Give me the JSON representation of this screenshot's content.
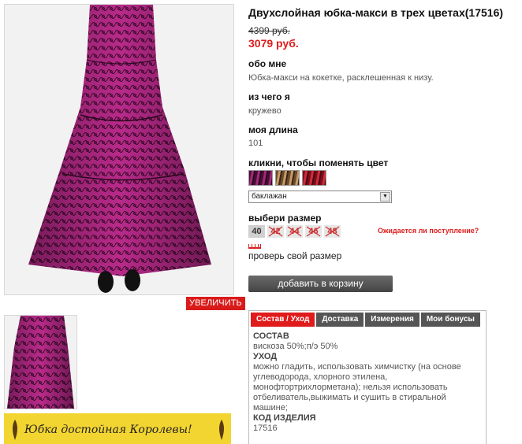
{
  "product": {
    "title": "Двухслойная юбка-макси в трех цветах(17516)",
    "old_price": "4399 руб.",
    "new_price": "3079 руб."
  },
  "gallery": {
    "zoom_label": "УВЕЛИЧИТЬ",
    "promo_text": "Юбка достойная Королевы!"
  },
  "about": {
    "label": "обо мне",
    "value": "Юбка-макси на кокетке, расклешенная к низу."
  },
  "material": {
    "label": "из чего я",
    "value": "кружево"
  },
  "length": {
    "label": "моя длина",
    "value": "101"
  },
  "colors": {
    "label": "кликни, чтобы поменять цвет",
    "selected": "баклажан",
    "swatch_colors": [
      "#a12a7a",
      "#c49a6a",
      "#d12a3c"
    ]
  },
  "sizes": {
    "label": "выбери размер",
    "items": [
      "40",
      "42",
      "44",
      "46",
      "48"
    ],
    "waiting_label": "Ожидается ли поступление?",
    "check_label": "проверь свой размер"
  },
  "cart": {
    "button_label": "добавить в корзину"
  },
  "tabs": {
    "items": [
      "Состав / Уход",
      "Доставка",
      "Измерения",
      "Мои бонусы"
    ],
    "content": {
      "composition_heading": "СОСТАВ",
      "composition": "вискоза 50%;п/э 50%",
      "care_heading": "УХОД",
      "care": "можно гладить, использовать химчистку (на основе углеводорода, хлорного этилена, монофтортрихлорметана); нельзя использовать отбеливатель,выжимать и сушить в стиральной машине;",
      "code_heading": "КОД ИЗДЕЛИЯ",
      "code": "17516"
    }
  },
  "accent_color": "#e01b1b"
}
